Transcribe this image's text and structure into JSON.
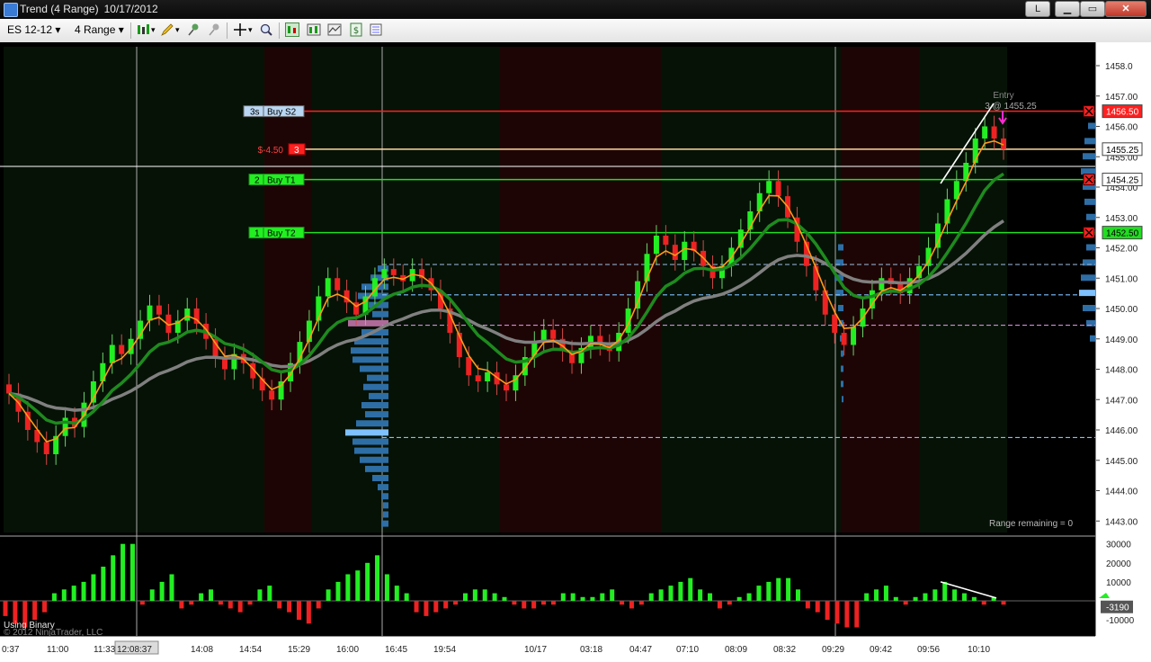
{
  "window": {
    "title_name": "Trend (4 Range)",
    "title_date": "10/17/2012",
    "btn_l": "L",
    "btn_min": "▁",
    "btn_max": "▭",
    "btn_close": "✕"
  },
  "toolbar": {
    "instrument": "ES 12-12",
    "period": "4 Range"
  },
  "chart": {
    "price_ticks": [
      "1458.0",
      "1457.00",
      "1456.00",
      "1455.00",
      "1454.00",
      "1453.00",
      "1452.00",
      "1451.00",
      "1450.00",
      "1449.00",
      "1448.00",
      "1447.00",
      "1446.00",
      "1445.00",
      "1444.00",
      "1443.00"
    ],
    "price_tags": {
      "p1": "1456.50",
      "p2": "1455.25",
      "p3": "1454.25",
      "p4": "1452.50"
    },
    "orders": {
      "s2": {
        "qty": "3s",
        "label": "Buy S2"
      },
      "pnl": "$-4.50",
      "pos_qty": "3",
      "t1": {
        "qty": "2",
        "label": "Buy T1"
      },
      "t2": {
        "qty": "1",
        "label": "Buy T2"
      }
    },
    "entry": {
      "label": "Entry",
      "detail": "3 @ 1455.25"
    },
    "range_remaining": "Range remaining = 0",
    "osc_ticks": [
      "30000",
      "20000",
      "10000",
      "-10000"
    ],
    "osc_value": "-3190",
    "indicator_name": "Using Binary",
    "copyright": "© 2012 NinjaTrader, LLC",
    "time_labels": [
      "0:37",
      "11:00",
      "11:33",
      "12:08:37",
      "14:08",
      "14:54",
      "15:29",
      "16:00",
      "16:45",
      "19:54",
      "10/17",
      "03:18",
      "04:47",
      "07:10",
      "08:09",
      "08:32",
      "09:29",
      "09:42",
      "09:56",
      "10:10"
    ]
  },
  "colors": {
    "buy_line": "#22dd22",
    "target_line": "#ff2020",
    "fast_ema": "#ff9a1a",
    "mid_ema": "#1e8a1e",
    "slow_ema": "#808080"
  }
}
